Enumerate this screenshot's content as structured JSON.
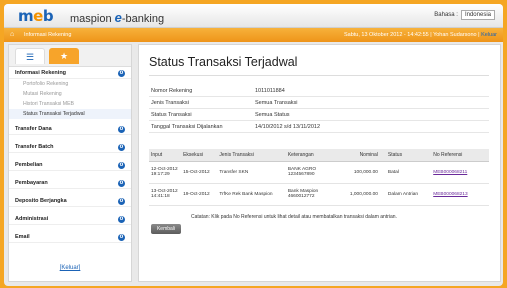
{
  "header": {
    "logo_left": "m",
    "logo_mid": "e",
    "logo_right": "b",
    "app_prefix": "maspion ",
    "app_e": "e",
    "app_suffix": "-banking",
    "language_label": "Bahasa :",
    "language_value": "Indonesia"
  },
  "topbar": {
    "home_icon": "⌂",
    "breadcrumb": "Informasi Rekening",
    "session_info": "Sabtu, 13 Oktober 2012 - 14:42:55 | Yohan Sudarsono |",
    "logout_link": "Keluar"
  },
  "sidebar": {
    "tab1_icon": "☰",
    "tab2_icon": "★",
    "sections": [
      {
        "label": "Informasi Rekening",
        "toggle": "o"
      },
      {
        "label": "Transfer Dana",
        "toggle": "o"
      },
      {
        "label": "Transfer Batch",
        "toggle": "o"
      },
      {
        "label": "Pembelian",
        "toggle": "o"
      },
      {
        "label": "Pembayaran",
        "toggle": "o"
      },
      {
        "label": "Deposito Berjangka",
        "toggle": "o"
      },
      {
        "label": "Administrasi",
        "toggle": "o"
      },
      {
        "label": "Email",
        "toggle": "o"
      }
    ],
    "sub_items": [
      "Portofolio Rekening",
      "Mutasi Rekening",
      "Histori Transaksi MEB",
      "Status Transaksi Terjadwal"
    ],
    "logout": "[Keluar]"
  },
  "main": {
    "title": "Status Transaksi Terjadwal",
    "summary": [
      {
        "key": "Nomor Rekening",
        "value": "1011011884"
      },
      {
        "key": "Jenis Transaksi",
        "value": "Semua Transaksi"
      },
      {
        "key": "Status Transaksi",
        "value": "Semua Status"
      },
      {
        "key": "Tanggal Transaksi Dijalankan",
        "value": "14/10/2012 s/d 13/11/2012"
      }
    ],
    "columns": [
      "Input",
      "Eksekusi",
      "Jenis Transaksi",
      "Keterangan",
      "Nominal",
      "Status",
      "No Referensi"
    ],
    "rows": [
      {
        "input_date": "12-Oct-2012",
        "input_time": "19:17:29",
        "execution": "15-Oct-2012",
        "type": "Transfer SKN",
        "desc1": "BANK AGRO",
        "desc2": "1234567890",
        "amount": "100,000.00",
        "status": "Batal",
        "ref": "MEB000068211"
      },
      {
        "input_date": "13-Oct-2012",
        "input_time": "14:41:18",
        "execution": "19-Oct-2012",
        "type": "TrfKe Rek Bank Maspion",
        "desc1": "Bank Maspion",
        "desc2": "4660012772",
        "amount": "1,000,000.00",
        "status": "Dalam Antrian",
        "ref": "MEB000068213"
      }
    ],
    "note": "Catatan: Klik pada No Referensi untuk lihat detail atau membatalkan transaksi dalam antrian.",
    "back_button": "Kembali"
  }
}
